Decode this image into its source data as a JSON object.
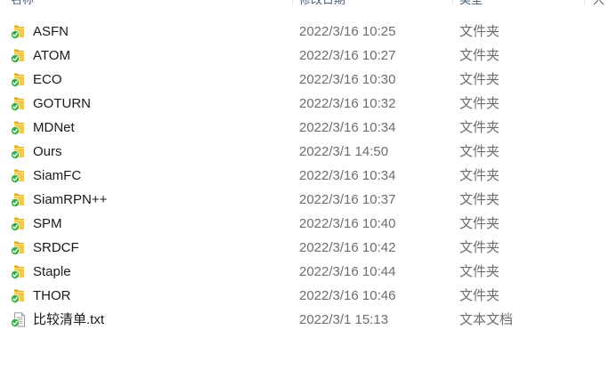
{
  "header": {
    "name_label": "名称",
    "date_label": "修改日期",
    "type_label": "类型",
    "size_label": "大"
  },
  "files": [
    {
      "name": "ASFN",
      "date": "2022/3/16 10:25",
      "type": "文件夹",
      "icon": "folder-icon"
    },
    {
      "name": "ATOM",
      "date": "2022/3/16 10:27",
      "type": "文件夹",
      "icon": "folder-icon"
    },
    {
      "name": "ECO",
      "date": "2022/3/16 10:30",
      "type": "文件夹",
      "icon": "folder-icon"
    },
    {
      "name": "GOTURN",
      "date": "2022/3/16 10:32",
      "type": "文件夹",
      "icon": "folder-icon"
    },
    {
      "name": "MDNet",
      "date": "2022/3/16 10:34",
      "type": "文件夹",
      "icon": "folder-icon"
    },
    {
      "name": "Ours",
      "date": "2022/3/1 14:50",
      "type": "文件夹",
      "icon": "folder-icon"
    },
    {
      "name": "SiamFC",
      "date": "2022/3/16 10:34",
      "type": "文件夹",
      "icon": "folder-icon"
    },
    {
      "name": "SiamRPN++",
      "date": "2022/3/16 10:37",
      "type": "文件夹",
      "icon": "folder-icon"
    },
    {
      "name": "SPM",
      "date": "2022/3/16 10:40",
      "type": "文件夹",
      "icon": "folder-icon"
    },
    {
      "name": "SRDCF",
      "date": "2022/3/16 10:42",
      "type": "文件夹",
      "icon": "folder-icon"
    },
    {
      "name": "Staple",
      "date": "2022/3/16 10:44",
      "type": "文件夹",
      "icon": "folder-icon"
    },
    {
      "name": "THOR",
      "date": "2022/3/16 10:46",
      "type": "文件夹",
      "icon": "folder-icon"
    },
    {
      "name": "比较清单.txt",
      "date": "2022/3/1 15:13",
      "type": "文本文档",
      "icon": "text-file-icon"
    }
  ],
  "colors": {
    "folder": "#f2c94c",
    "folder_dark": "#dcae2c",
    "sync_check": "#3cb043",
    "date_text": "#6d6d6d",
    "header_text": "#4c607a"
  }
}
